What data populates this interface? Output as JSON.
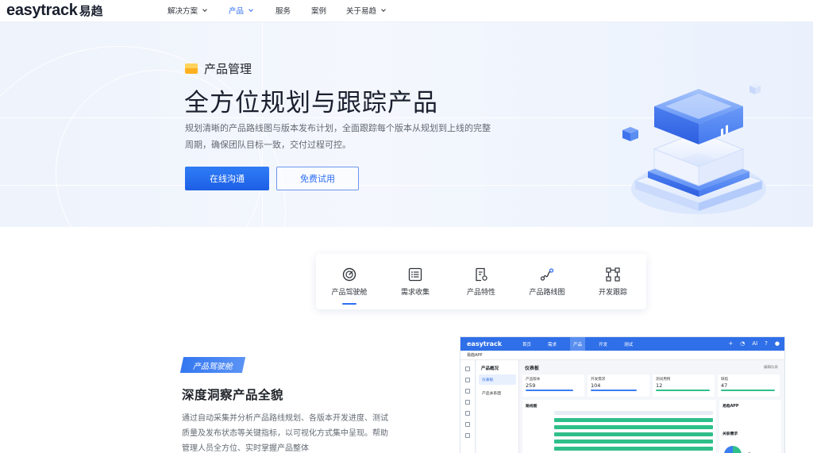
{
  "brand": {
    "logo_text": "easytrack",
    "logo_cn": "易趋"
  },
  "nav": {
    "items": [
      {
        "label": "解决方案",
        "has_dropdown": true,
        "active": false
      },
      {
        "label": "产品",
        "has_dropdown": true,
        "active": true
      },
      {
        "label": "服务",
        "has_dropdown": false,
        "active": false
      },
      {
        "label": "案例",
        "has_dropdown": false,
        "active": false
      },
      {
        "label": "关于易趋",
        "has_dropdown": true,
        "active": false
      }
    ]
  },
  "hero": {
    "tag": "产品管理",
    "title": "全方位规划与跟踪产品",
    "description": "规划清晰的产品路线图与版本发布计划，全面跟踪每个版本从规划到上线的完整周期，确保团队目标一致，交付过程可控。",
    "primary_button": "在线沟通",
    "secondary_button": "免费试用"
  },
  "tabs": [
    {
      "label": "产品驾驶舱",
      "icon": "dashboard-icon",
      "active": true
    },
    {
      "label": "需求收集",
      "icon": "list-icon",
      "active": false
    },
    {
      "label": "产品特性",
      "icon": "feature-icon",
      "active": false
    },
    {
      "label": "产品路线图",
      "icon": "roadmap-icon",
      "active": false
    },
    {
      "label": "开发跟踪",
      "icon": "tracking-icon",
      "active": false
    }
  ],
  "feature": {
    "tag": "产品驾驶舱",
    "title": "深度洞察产品全貌",
    "description": "通过自动采集并分析产品路线规划、各版本开发进度、测试质量及发布状态等关键指标，以可视化方式集中呈现。帮助管理人员全方位、实时掌握产品整体"
  },
  "app_preview": {
    "logo": "easytrack",
    "menu": [
      "首页",
      "需求",
      "产品",
      "开发",
      "测试"
    ],
    "active_menu": "产品",
    "sub_title": "易趋APP",
    "side_title": "产品概况",
    "side_items": [
      "仪表板",
      "产品关系图"
    ],
    "main_title": "仪表板",
    "main_link": "编辑仪表",
    "stats": [
      {
        "label": "产品版本",
        "value": "259"
      },
      {
        "label": "开发需求",
        "value": "104"
      },
      {
        "label": "测试用例",
        "value": "12"
      },
      {
        "label": "缺陷",
        "value": "47"
      }
    ],
    "roadmap_title": "路线图",
    "right_card_title": "易趋APP",
    "right_card_sub": "关联需求",
    "pie_value": "3"
  },
  "colors": {
    "primary": "#2e6ff2",
    "accent_yellow": "#ffb020",
    "text": "#1f2329",
    "muted": "#646a73"
  }
}
